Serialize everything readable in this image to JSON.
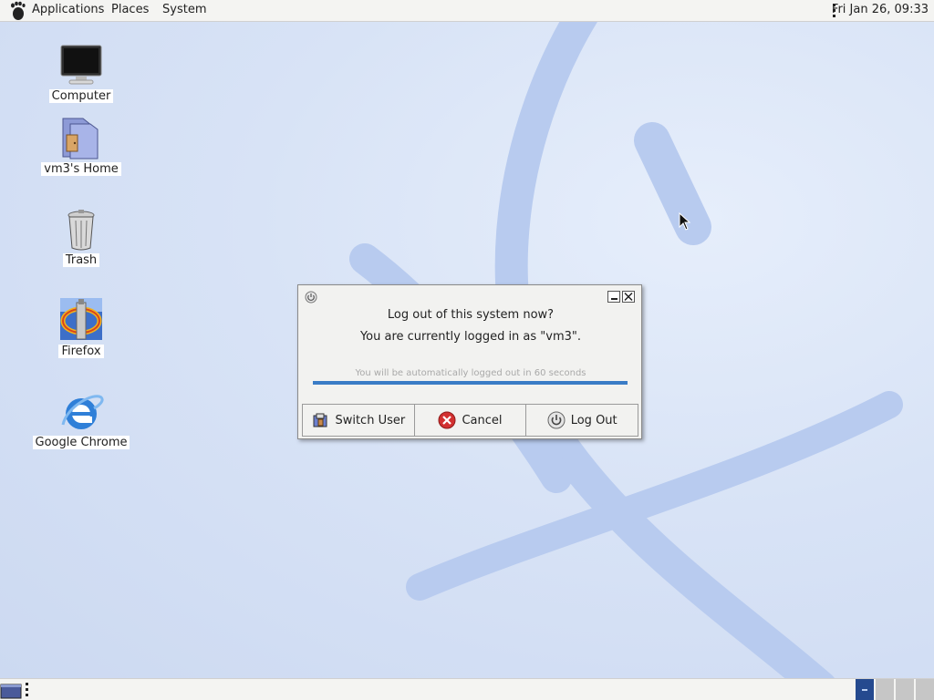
{
  "top_panel": {
    "menus": [
      "Applications",
      "Places",
      "System"
    ],
    "clock": "Fri Jan 26, 09:33",
    "logo_icon": "gnome-foot-icon"
  },
  "desktop_icons": [
    {
      "label": "Computer",
      "icon": "computer-monitor-icon"
    },
    {
      "label": "vm3's Home",
      "icon": "home-folder-icon"
    },
    {
      "label": "Trash",
      "icon": "trash-can-icon"
    },
    {
      "label": "Firefox",
      "icon": "firefox-icon"
    },
    {
      "label": "Google Chrome",
      "icon": "internet-explorer-icon"
    }
  ],
  "logout_dialog": {
    "title": "Log out of this system now?",
    "subtitle": "You are currently logged in as \"vm3\".",
    "auto_text": "You will be automatically logged out in 60 seconds",
    "progress": 1.0,
    "buttons": {
      "switch_user": "Switch User",
      "cancel": "Cancel",
      "log_out": "Log Out"
    }
  },
  "bottom_panel": {
    "workspaces": 4,
    "active_workspace": 1
  },
  "colors": {
    "panel": "#f4f4f2",
    "desktop": "#d3dff3",
    "accent": "#3a7cc6",
    "workspace_active": "#254a8f"
  }
}
